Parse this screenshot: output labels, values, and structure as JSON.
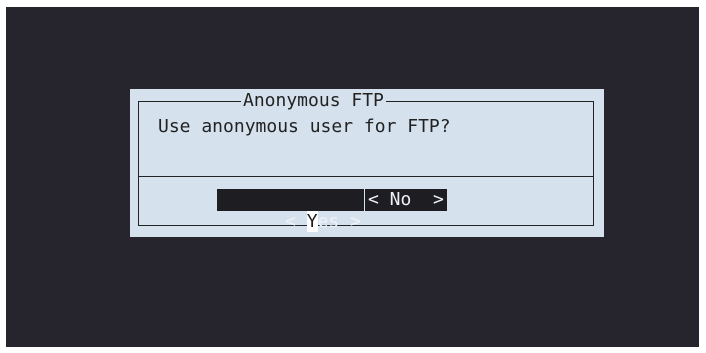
{
  "dialog": {
    "title": "Anonymous FTP",
    "message": "Use anonymous user for FTP?",
    "buttons": {
      "yes": {
        "left": "< ",
        "hotkey": "Y",
        "rest": "es >"
      },
      "no": {
        "label": "< No  >"
      }
    }
  },
  "colors": {
    "terminal_bg": "#26242d",
    "dialog_bg": "#d5e2ee",
    "button_bg": "#1e1d22",
    "button_text": "#eef2f8",
    "text": "#222222"
  }
}
